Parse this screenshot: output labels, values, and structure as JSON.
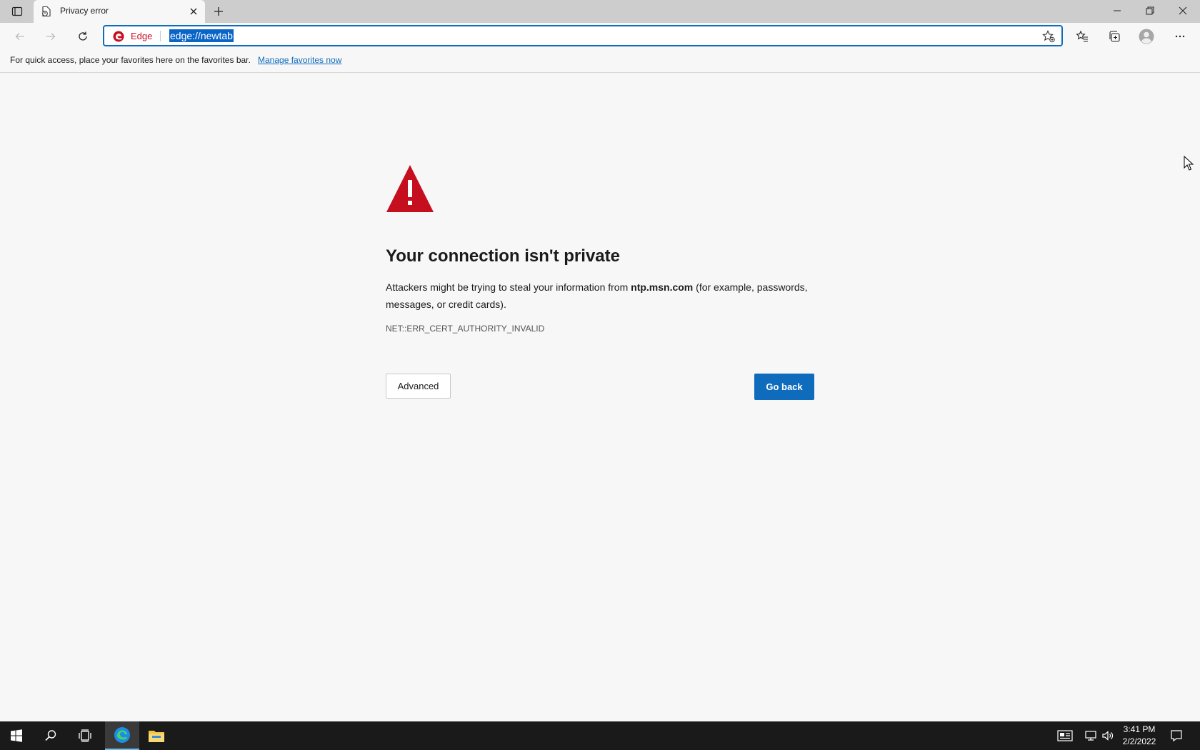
{
  "tab": {
    "title": "Privacy error"
  },
  "address_bar": {
    "site_label": "Edge",
    "url": "edge://newtab"
  },
  "favorites_bar": {
    "text": "For quick access, place your favorites here on the favorites bar.",
    "link": "Manage favorites now"
  },
  "error_page": {
    "title": "Your connection isn't private",
    "message_before": "Attackers might be trying to steal your information from ",
    "domain": "ntp.msn.com",
    "message_after": " (for example, passwords, messages, or credit cards).",
    "error_code": "NET::ERR_CERT_AUTHORITY_INVALID",
    "advanced_label": "Advanced",
    "go_back_label": "Go back"
  },
  "taskbar": {
    "time": "3:41 PM",
    "date": "2/2/2022"
  },
  "colors": {
    "accent": "#0f6cbd",
    "warning": "#c50f1f",
    "taskbar": "#1a1a1a"
  }
}
